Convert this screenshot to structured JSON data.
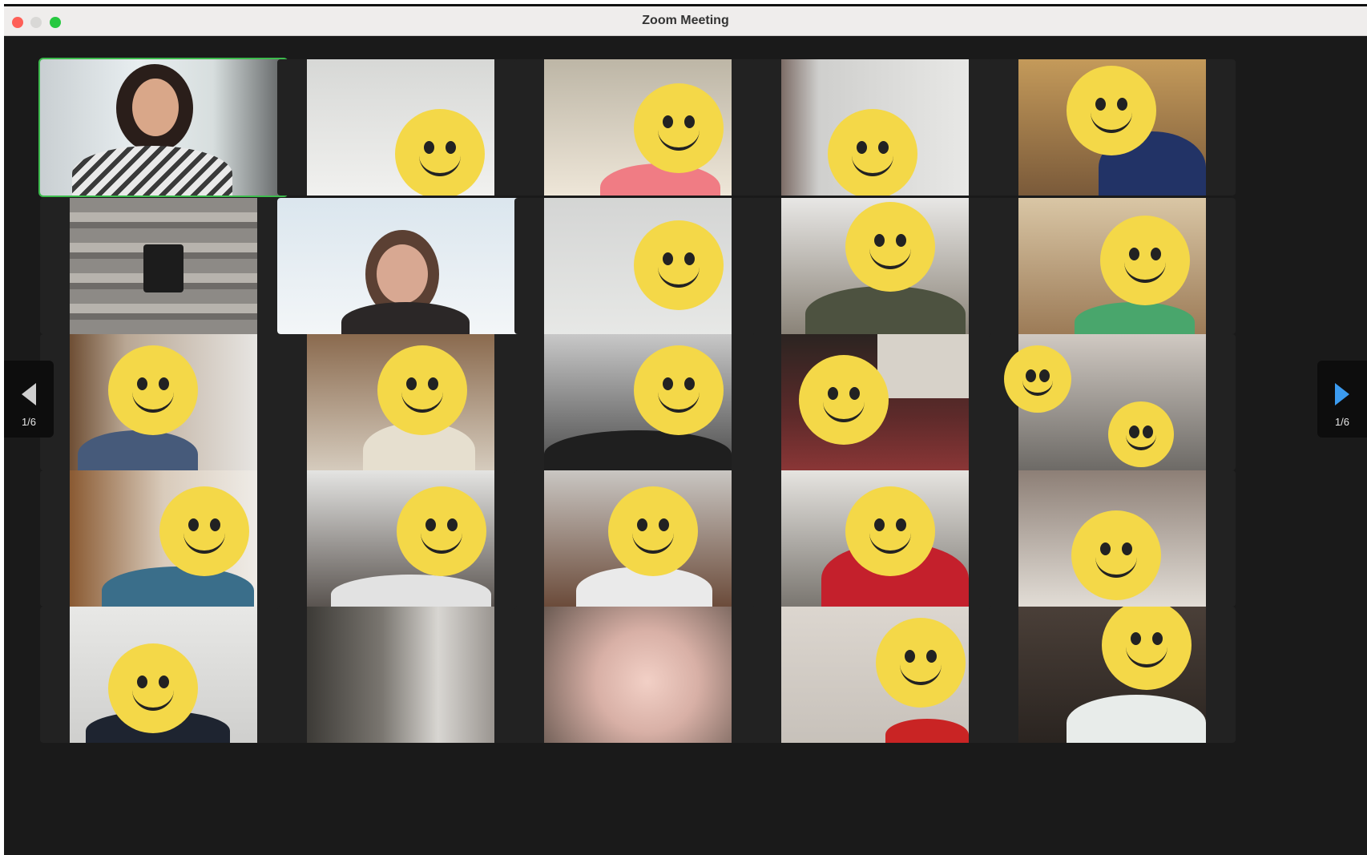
{
  "window": {
    "title": "Zoom Meeting"
  },
  "pager": {
    "prev_label": "1/6",
    "next_label": "1/6"
  },
  "colors": {
    "active_border": "#3dbb4d",
    "next_arrow": "#3b9bf0",
    "emoji": "#f4d848"
  }
}
